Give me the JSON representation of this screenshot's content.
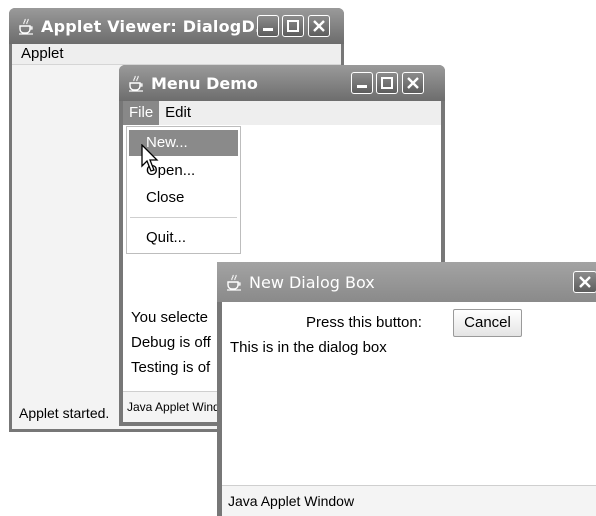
{
  "applet_viewer": {
    "title": "Applet Viewer: DialogD...",
    "menu_label": "Applet",
    "status": "Applet started."
  },
  "menu_demo": {
    "title": "Menu Demo",
    "menus": [
      "File",
      "Edit"
    ],
    "file_menu_items": [
      "New...",
      "Open...",
      "Close",
      "Quit..."
    ],
    "highlighted_item": "New...",
    "messages": [
      "You selecte",
      "Debug is off",
      "Testing is of"
    ],
    "status": "Java Applet Window"
  },
  "new_dialog": {
    "title": "New Dialog Box",
    "prompt": "Press this button:",
    "cancel_label": "Cancel",
    "body_text": "This is in the dialog box",
    "status": "Java Applet Window"
  },
  "icons": {
    "window_icon": "java-cup-icon",
    "minimize": "minimize-icon",
    "maximize": "maximize-icon",
    "close": "close-icon",
    "cursor": "arrow-cursor-icon"
  },
  "colors": {
    "titlebar": "#7f7f7f",
    "menu_highlight": "#8a8a8a",
    "client_bg": "#ffffff"
  }
}
